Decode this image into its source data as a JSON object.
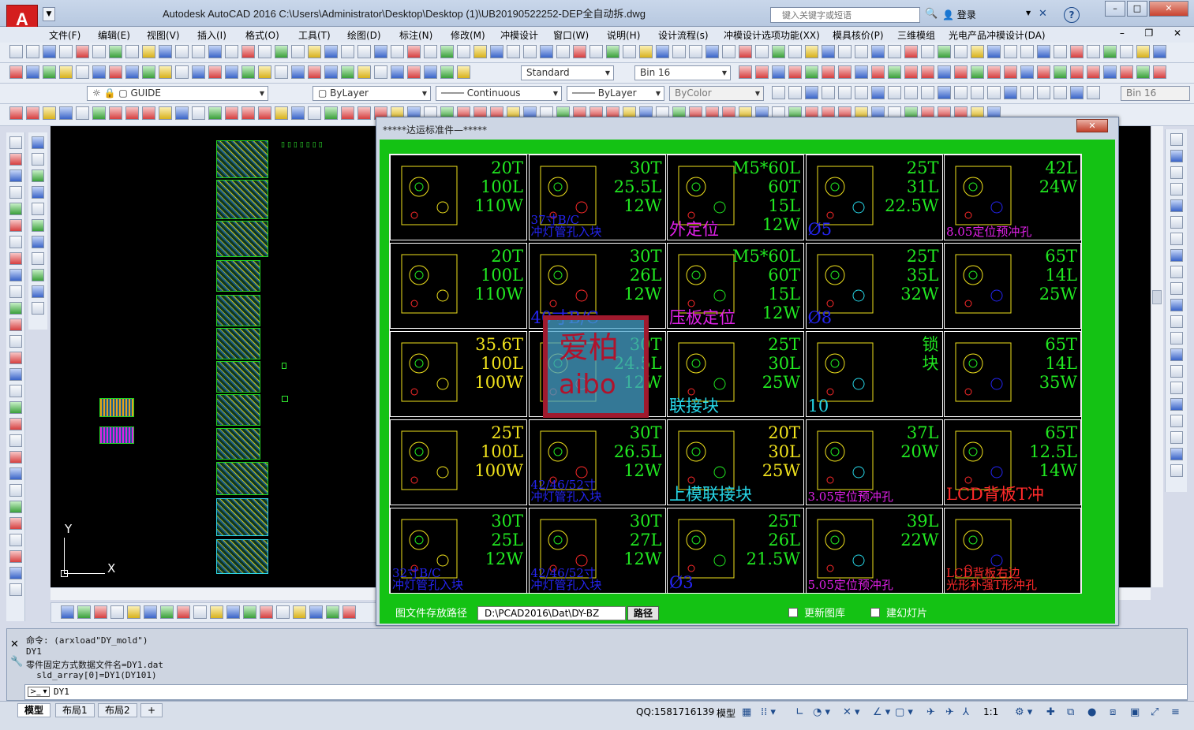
{
  "window": {
    "app_title": "Autodesk AutoCAD 2016     C:\\Users\\Administrator\\Desktop\\Desktop (1)\\UB20190522252-DEP全自动拆.dwg",
    "search_placeholder": "键入关键字或短语",
    "login_label": "登录"
  },
  "menu": [
    "文件(F)",
    "编辑(E)",
    "视图(V)",
    "插入(I)",
    "格式(O)",
    "工具(T)",
    "绘图(D)",
    "标注(N)",
    "修改(M)",
    "冲模设计",
    "窗口(W)",
    "说明(H)",
    "设计流程(s)",
    "冲模设计选项功能(XX)",
    "模具核价(P)",
    "三维模组",
    "光电产品冲模设计(DA)"
  ],
  "toolbar": {
    "text_style": "Standard",
    "dim_style": "Bin 16",
    "layer": "GUIDE",
    "color": "ByLayer",
    "linetype": "Continuous",
    "lineweight": "ByLayer",
    "plotstyle": "ByColor",
    "right_style": "Bin 16"
  },
  "dialog": {
    "title": "*****达运标准件—*****",
    "path_label": "图文件存放路径",
    "path_value": "D:\\PCAD2016\\Dat\\DY-BZ",
    "path_button": "路径",
    "update_label": "更新图库",
    "light_label": "建幻灯片",
    "cells": [
      {
        "text": "20T\n100L\n110W",
        "label": "",
        "color": "#21e821",
        "label_color": ""
      },
      {
        "text": "30T\n25.5L\n12W",
        "label": "37寸B/C\n冲灯管孔入块",
        "color": "#21e821",
        "label_color": "#2424f0"
      },
      {
        "text": "M5*60L\n60T\n15L\n12W",
        "label": "外定位",
        "color": "#21e821",
        "label_color": "#e021e8"
      },
      {
        "text": "25T\n31L\n22.5W",
        "label": "Ø5",
        "color": "#21e821",
        "label_color": "#2424f0"
      },
      {
        "text": "42L\n24W",
        "label": "8.05定位预冲孔",
        "color": "#21e821",
        "label_color": "#e021e8"
      },
      {
        "text": "20T\n100L\n110W",
        "label": "",
        "color": "#21e821",
        "label_color": ""
      },
      {
        "text": "30T\n26L\n12W",
        "label": "40寸B/C",
        "color": "#21e821",
        "label_color": "#2424f0"
      },
      {
        "text": "M5*60L\n60T\n15L\n12W",
        "label": "压板定位",
        "color": "#21e821",
        "label_color": "#e021e8"
      },
      {
        "text": "25T\n35L\n32W",
        "label": "Ø8",
        "color": "#21e821",
        "label_color": "#2424f0"
      },
      {
        "text": "65T\n14L\n25W",
        "label": "",
        "color": "#21e821",
        "label_color": ""
      },
      {
        "text": "35.6T\n100L\n100W",
        "label": "",
        "color": "#f0e21c",
        "label_color": ""
      },
      {
        "text": "30T\n24.5L\n12W",
        "label": "",
        "color": "#21e821",
        "label_color": "#2424f0"
      },
      {
        "text": "25T\n30L\n25W",
        "label": "联接块",
        "color": "#21e821",
        "label_color": "#27d7e8"
      },
      {
        "text": "锁\n块",
        "label": "10",
        "color": "#21e821",
        "label_color": "#27d7e8"
      },
      {
        "text": "65T\n14L\n35W",
        "label": "",
        "color": "#21e821",
        "label_color": ""
      },
      {
        "text": "25T\n100L\n100W",
        "label": "",
        "color": "#f0e21c",
        "label_color": ""
      },
      {
        "text": "30T\n26.5L\n12W",
        "label": "42/46/52寸\n冲灯管孔入块",
        "color": "#21e821",
        "label_color": "#2424f0"
      },
      {
        "text": "20T\n30L\n25W",
        "label": "上模联接块",
        "color": "#f0e21c",
        "label_color": "#27d7e8"
      },
      {
        "text": "37L\n20W",
        "label": "3.05定位预冲孔",
        "color": "#21e821",
        "label_color": "#e021e8"
      },
      {
        "text": "65T\n12.5L\n14W",
        "label": "LCD背板T冲",
        "color": "#21e821",
        "label_color": "#ff2a2a"
      },
      {
        "text": "30T\n25L\n12W",
        "label": "32寸B/C\n冲灯管孔入块",
        "color": "#21e821",
        "label_color": "#2424f0"
      },
      {
        "text": "30T\n27L\n12W",
        "label": "42/46/52寸\n冲灯管孔入块",
        "color": "#21e821",
        "label_color": "#2424f0"
      },
      {
        "text": "25T\n26L\n21.5W",
        "label": "Ø3",
        "color": "#21e821",
        "label_color": "#2424f0"
      },
      {
        "text": "39L\n22W",
        "label": "5.05定位预冲孔",
        "color": "#21e821",
        "label_color": "#e021e8"
      },
      {
        "text": "",
        "label": "LCD背板右边\n光形补强T形冲孔",
        "color": "#21e821",
        "label_color": "#ff2a2a"
      }
    ]
  },
  "watermark": {
    "line1": "爱柏",
    "line2": "aibo"
  },
  "command": {
    "lines": [
      "命令: (arxload\"DY_mold\")",
      "DY1",
      "零件固定方式数据文件名=DY1.dat",
      "  sld_array[0]=DY1(DY101)"
    ],
    "input": "DY1"
  },
  "status": {
    "tabs": [
      "模型",
      "布局1",
      "布局2"
    ],
    "qq": "QQ:1581716139",
    "model": "模型",
    "scale": "1:1"
  },
  "canvas": {
    "ucs_x": "X",
    "ucs_y": "Y"
  }
}
